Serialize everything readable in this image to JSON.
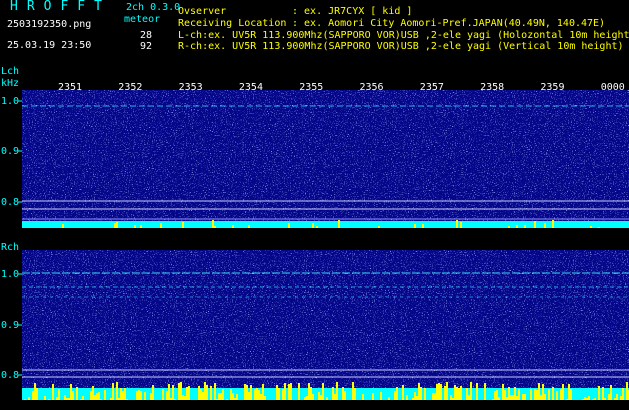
{
  "header": {
    "brand": "HROFFT",
    "version": "2ch 0.3.0",
    "meteor_label": "meteor",
    "filename": "2503192350.png",
    "timestamp": "25.03.19 23:50",
    "counts": {
      "lch": "28",
      "rch": "92"
    },
    "observer_label": "Ovserver",
    "observer_value": ": ex. JR7CYX [ kid ]",
    "location_label": "Receiving Location",
    "location_value": ": ex. Aomori City Aomori-Pref.JAPAN(40.49N, 140.47E)",
    "lch_line": "L-ch:ex. UV5R 113.900Mhz(SAPPORO VOR)USB ,2-ele yagi (Holozontal 10m height)",
    "rch_line": "R-ch:ex. UV5R 113.900Mhz(SAPPORO VOR)USB ,2-ele yagi (Vertical 10m height)"
  },
  "time_axis": [
    "2351",
    "2352",
    "2353",
    "2354",
    "2355",
    "2356",
    "2357",
    "2358",
    "2359",
    "0000"
  ],
  "lch_panel": {
    "channel_label": "Lch",
    "unit_label": "kHz",
    "freq_ticks": [
      "1.0",
      "0.9",
      "0.8"
    ]
  },
  "rch_panel": {
    "channel_label": "Rch",
    "freq_ticks": [
      "1.0",
      "0.9",
      "0.8"
    ]
  },
  "colors": {
    "background": "#000000",
    "spectrogram_bg": "#05078a",
    "signal": "#00ffff",
    "peaks": "#ffff00",
    "text_white": "#ffffff",
    "text_cyan": "#00ffff",
    "text_yellow": "#ffff00"
  }
}
